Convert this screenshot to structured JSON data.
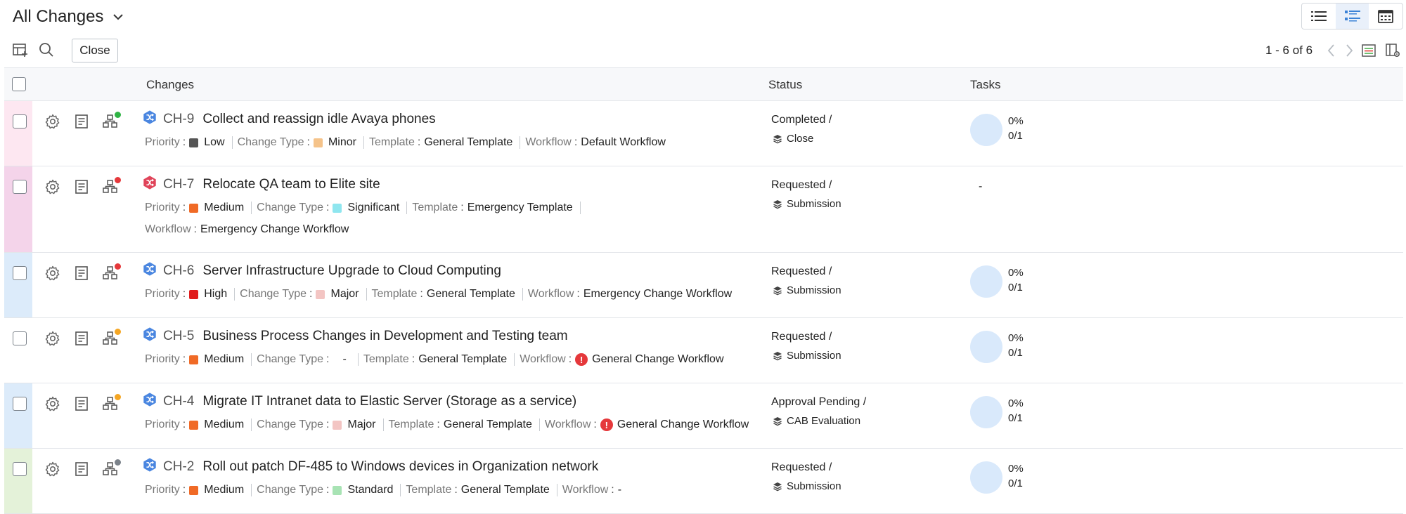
{
  "header": {
    "view_title": "All Changes"
  },
  "toolbar": {
    "close_label": "Close",
    "pagination": "1 - 6 of 6"
  },
  "table": {
    "columns": {
      "changes": "Changes",
      "status": "Status",
      "tasks": "Tasks"
    },
    "labels": {
      "priority": "Priority",
      "change_type": "Change Type",
      "template": "Template",
      "workflow": "Workflow"
    }
  },
  "colors": {
    "accent": "#3b82d6",
    "priority_low": "#555555",
    "priority_medium": "#f06a26",
    "priority_high": "#e01d1d",
    "type_minor": "#f5c38a",
    "type_significant": "#8fe6ef",
    "type_major": "#f3c5c3",
    "type_standard": "#a8e3b4"
  },
  "rows": [
    {
      "id": "CH-9",
      "title": "Collect and reassign idle Avaya phones",
      "type_icon": "normal-change-icon",
      "workflow_badge": "check-badge",
      "priority": "Low",
      "change_type": "Minor",
      "template": "General Template",
      "workflow": "Default Workflow",
      "workflow_warning": false,
      "status": "Completed /",
      "stage": "Close",
      "task_pct": "0%",
      "task_count": "0/1",
      "task_progress": 0,
      "row_color": "#fde7f1"
    },
    {
      "id": "CH-7",
      "title": "Relocate QA team to Elite site",
      "type_icon": "emergency-change-icon",
      "workflow_badge": "error-badge",
      "priority": "Medium",
      "change_type": "Significant",
      "template": "Emergency Template",
      "workflow": "Emergency Change Workflow",
      "workflow_warning": false,
      "status": "Requested /",
      "stage": "Submission",
      "task_dash": "-",
      "row_color": "#f4d4ea"
    },
    {
      "id": "CH-6",
      "title": "Server Infrastructure Upgrade to Cloud Computing",
      "type_icon": "normal-change-icon",
      "workflow_badge": "error-badge",
      "priority": "High",
      "change_type": "Major",
      "template": "General Template",
      "workflow": "Emergency Change Workflow",
      "workflow_warning": false,
      "status": "Requested /",
      "stage": "Submission",
      "task_pct": "0%",
      "task_count": "0/1",
      "task_progress": 0,
      "row_color": "#dcebfa"
    },
    {
      "id": "CH-5",
      "title": "Business Process Changes in Development and Testing team",
      "type_icon": "normal-change-icon",
      "workflow_badge": "pending-badge",
      "priority": "Medium",
      "change_type": "-",
      "template": "General Template",
      "workflow": "General Change Workflow",
      "workflow_warning": true,
      "status": "Requested /",
      "stage": "Submission",
      "task_pct": "0%",
      "task_count": "0/1",
      "task_progress": 0,
      "row_color": "#ffffff"
    },
    {
      "id": "CH-4",
      "title": "Migrate IT Intranet data to Elastic Server (Storage as a service)",
      "type_icon": "normal-change-icon",
      "workflow_badge": "pending-badge",
      "priority": "Medium",
      "change_type": "Major",
      "template": "General Template",
      "workflow": "General Change Workflow",
      "workflow_warning": true,
      "status": "Approval Pending /",
      "stage": "CAB Evaluation",
      "task_pct": "0%",
      "task_count": "0/1",
      "task_progress": 0,
      "row_color": "#dcebfa"
    },
    {
      "id": "CH-2",
      "title": "Roll out patch DF-485 to Windows devices in Organization network",
      "type_icon": "normal-change-icon",
      "workflow_badge": "none-badge",
      "priority": "Medium",
      "change_type": "Standard",
      "template": "General Template",
      "workflow": "-",
      "workflow_warning": false,
      "status": "Requested /",
      "stage": "Submission",
      "task_pct": "0%",
      "task_count": "0/1",
      "task_progress": 0,
      "row_color": "#e4f2d9"
    }
  ]
}
